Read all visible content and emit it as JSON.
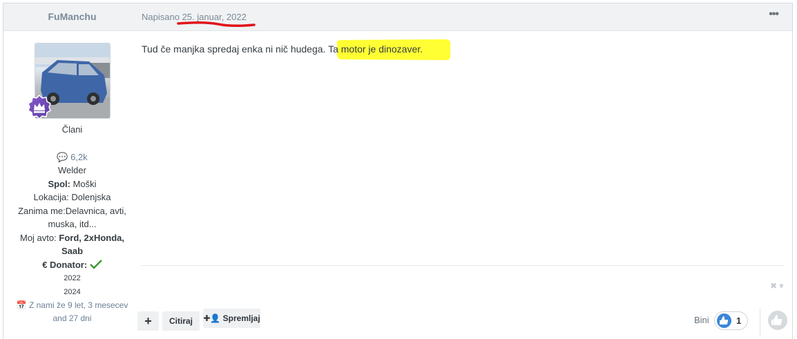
{
  "author": {
    "name": "FuManchu",
    "group": "Člani",
    "post_count": "6,2k",
    "title": "Welder",
    "gender_label": "Spol:",
    "gender_value": "Moški",
    "location_label": "Lokacija:",
    "location_value": "Dolenjska",
    "interests_line1": "Zanima me:Delavnica, avti,",
    "interests_line2": "muska, itd...",
    "car_label": "Moj avto:",
    "car_line1": "Ford, 2xHonda,",
    "car_line2": "Saab",
    "donator_label": "€ Donator:",
    "donator_year1": "2022",
    "donator_year2": "2024",
    "member_since_line1": "Z nami že 9 let, 3 mesecev",
    "member_since_line2": "and 27 dni"
  },
  "post": {
    "date_prefix": "Napisano",
    "date": "25. januar, 2022",
    "text_before": "Tud če manjka spredaj enka ni nič hudega.",
    "text_highlight": "Ta motor je dinozaver."
  },
  "actions": {
    "add_label": "+",
    "quote_label": "Citiraj",
    "follow_label": "Spremljaj"
  },
  "reactions": {
    "likers": "Bini",
    "count": "1"
  },
  "colors": {
    "highlight": "#ffff33",
    "underline": "#e0141b",
    "accent": "#3c87d8"
  }
}
